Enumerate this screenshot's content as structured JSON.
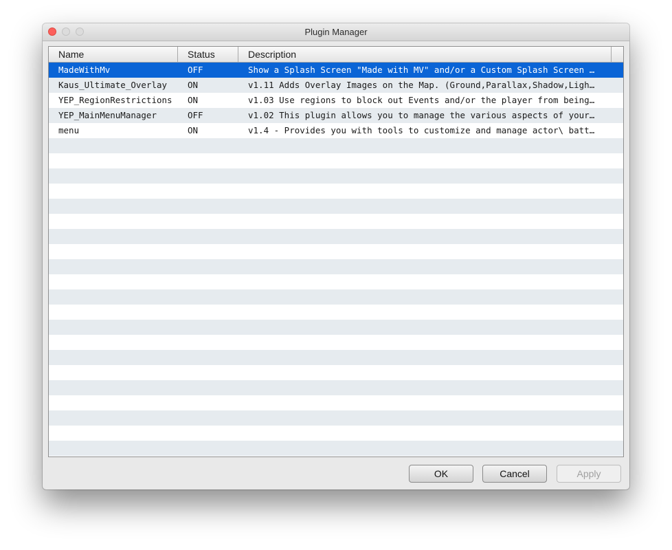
{
  "window": {
    "title": "Plugin Manager"
  },
  "table": {
    "columns": {
      "name": "Name",
      "status": "Status",
      "description": "Description"
    },
    "selected_row": 0,
    "rows": [
      {
        "name": "MadeWithMv",
        "status": "OFF",
        "description": "Show a Splash Screen \"Made with MV\" and/or a Custom Splash Screen …"
      },
      {
        "name": "Kaus_Ultimate_Overlay",
        "status": "ON",
        "description": "v1.11 Adds Overlay Images on the Map. (Ground,Parallax,Shadow,Ligh…"
      },
      {
        "name": "YEP_RegionRestrictions",
        "status": "ON",
        "description": "v1.03 Use regions to block out Events and/or the player from being…"
      },
      {
        "name": "YEP_MainMenuManager",
        "status": "OFF",
        "description": "v1.02 This plugin allows you to manage the various aspects of your…"
      },
      {
        "name": "menu",
        "status": "ON",
        "description": "v1.4 - Provides you with tools to customize and manage actor\\ batt…"
      }
    ]
  },
  "buttons": {
    "ok": "OK",
    "cancel": "Cancel",
    "apply": "Apply",
    "apply_enabled": false
  },
  "colors": {
    "selection": "#0a64d6",
    "stripe": "#e6ebef",
    "close_button": "#fc605c"
  }
}
